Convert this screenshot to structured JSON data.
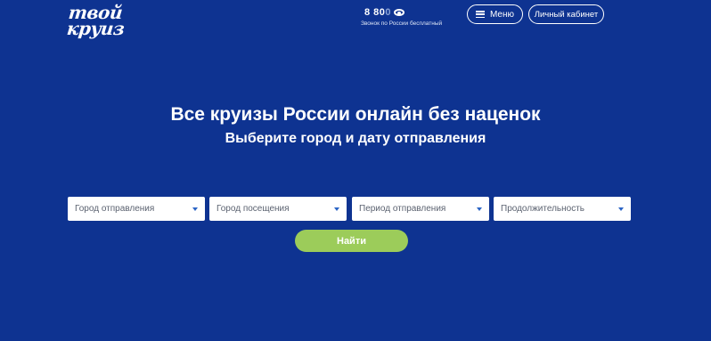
{
  "logo": {
    "line1": "твой",
    "line2": "круиз"
  },
  "header": {
    "phone_visible": "8 80",
    "phone_faded": "0",
    "phone_sub": "Звонок по России бесплатный",
    "menu_label": "Меню",
    "cabinet_label": "Личный кабинет"
  },
  "hero": {
    "title": "Все круизы России онлайн без наценок",
    "subtitle": "Выберите город и дату отправления"
  },
  "search": {
    "filters": [
      {
        "placeholder": "Город отправления"
      },
      {
        "placeholder": "Город посещения"
      },
      {
        "placeholder": "Период отправления"
      },
      {
        "placeholder": "Продолжительность"
      }
    ],
    "submit_label": "Найти"
  },
  "colors": {
    "background": "#0e3391",
    "button_green": "#9ccc5a",
    "caret_blue": "#2a64c5"
  },
  "icons": [
    "eye-icon",
    "menu-icon",
    "chevron-down-icon"
  ]
}
